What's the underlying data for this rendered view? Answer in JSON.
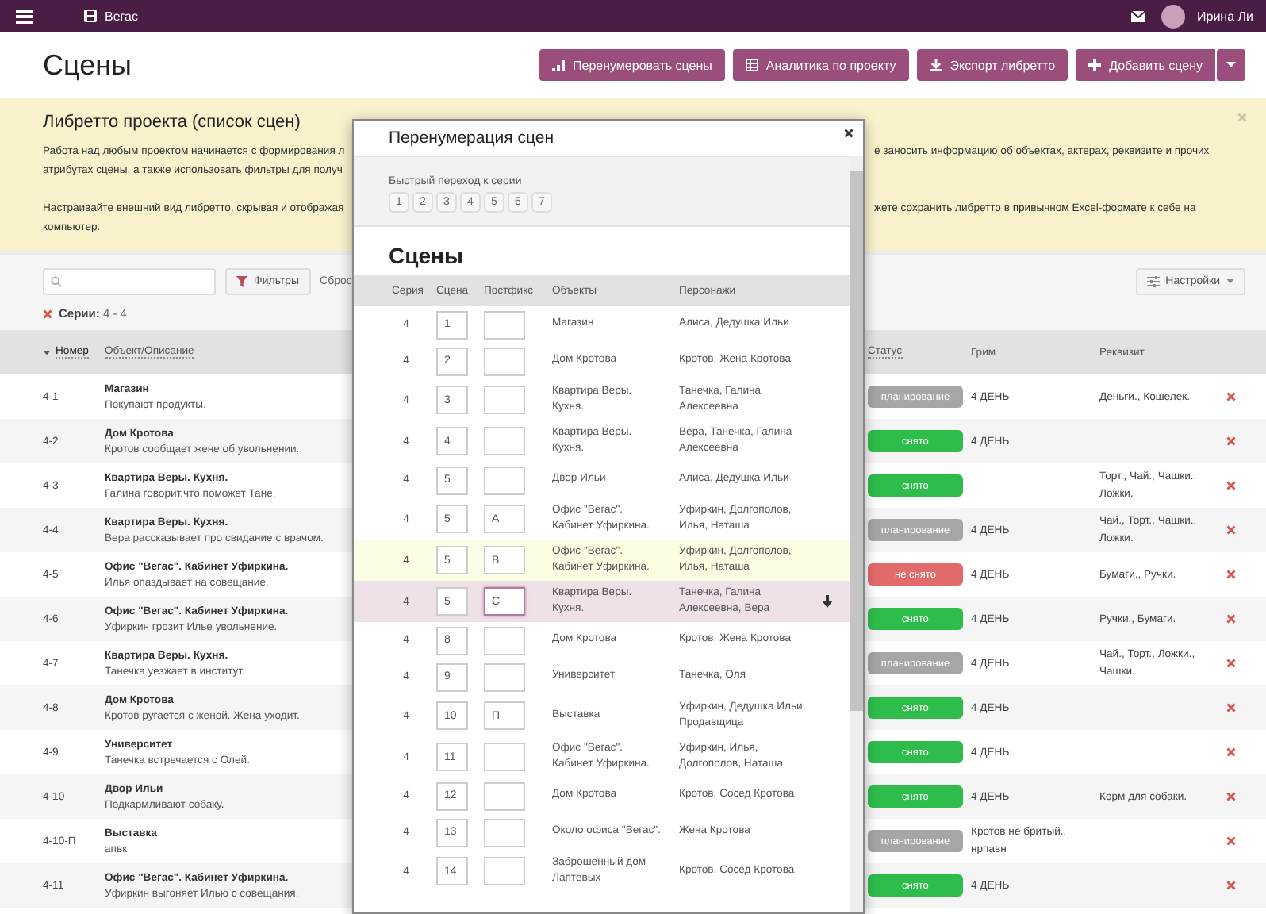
{
  "topbar": {
    "project": "Вегас",
    "user": "Ирина Ли"
  },
  "header": {
    "title": "Сцены",
    "buttons": [
      {
        "label": "Перенумеровать сцены",
        "kind": "bars",
        "dropdown": false
      },
      {
        "label": "Аналитика по проекту",
        "kind": "table",
        "dropdown": false
      },
      {
        "label": "Экспорт либретто",
        "kind": "download",
        "dropdown": false
      },
      {
        "label": "Добавить сцену",
        "kind": "plus",
        "dropdown": true
      }
    ]
  },
  "info": {
    "title": "Либретто проекта (список сцен)",
    "paragraphs": [
      [
        {
          "left": "Работа над любым проектом начинается с формирования л",
          "right": "е заносить информацию об объектах, актерах, реквизите и прочих"
        },
        {
          "left": "атрибутах сцены, а также использовать фильтры для получ"
        }
      ],
      [
        {
          "left": "Настраивайте внешний вид либретто, скрывая и отображая",
          "right": "жете сохранить либретто в привычном Excel-формате к себе на"
        },
        {
          "left": "компьютер."
        }
      ]
    ]
  },
  "filters": {
    "filter_button": "Фильтры",
    "reset_link": "Сброс",
    "active_filter": "**Серии:** 4 - 4",
    "settings_button": "Настройки"
  },
  "table": {
    "columns": [
      {
        "label": "Номер",
        "sorted": true,
        "sortable": true
      },
      {
        "label": "Объект/Описание",
        "sorted": false,
        "sortable": true
      },
      {
        "label": "Статус",
        "sorted": false,
        "sortable": true
      },
      {
        "label": "Грим",
        "sorted": false,
        "sortable": false
      },
      {
        "label": "Реквизит",
        "sorted": false,
        "sortable": false
      }
    ],
    "rows": [
      {
        "number": "4-1",
        "object": "Магазин",
        "description": "Покупают продукты.",
        "status": "планирование",
        "color": "#a6a6a6",
        "makeup": "4 ДЕНЬ",
        "props": "Деньги., Кошелек."
      },
      {
        "number": "4-2",
        "object": "Дом Кротова",
        "description": "Кротов сообщает жене об увольнении.",
        "status": "снято",
        "color": "#2ebd4a",
        "makeup": "4 ДЕНЬ"
      },
      {
        "number": "4-3",
        "object": "Квартира Веры. Кухня.",
        "description": "Галина говорит,что поможет Тане.",
        "status": "снято",
        "color": "#2ebd4a",
        "props": "Торт., Чай., Чашки., Ложки."
      },
      {
        "number": "4-4",
        "object": "Квартира Веры. Кухня.",
        "description": "Вера рассказывает про свидание с врачом.",
        "status": "планирование",
        "color": "#a6a6a6",
        "makeup": "4 ДЕНЬ",
        "props": "Чай., Торт., Чашки., Ложки."
      },
      {
        "number": "4-5",
        "object": "Офис \"Вегас\". Кабинет Уфиркина.",
        "description": "Илья опаздывает на совещание.",
        "status": "не снято",
        "color": "#e36a6a",
        "makeup": "4 ДЕНЬ",
        "props": "Бумаги., Ручки."
      },
      {
        "number": "4-6",
        "object": "Офис \"Вегас\". Кабинет Уфиркина.",
        "description": "Уфиркин грозит Илье увольнение.",
        "status": "снято",
        "color": "#2ebd4a",
        "makeup": "4 ДЕНЬ",
        "props": "Ручки., Бумаги."
      },
      {
        "number": "4-7",
        "object": "Квартира Веры. Кухня.",
        "description": "Танечка уезжает в институт.",
        "status": "планирование",
        "color": "#a6a6a6",
        "makeup": "4 ДЕНЬ",
        "props": "Чай., Торт., Ложки., Чашки."
      },
      {
        "number": "4-8",
        "object": "Дом Кротова",
        "description": "Кротов ругается с женой. Жена уходит.",
        "status": "снято",
        "color": "#2ebd4a",
        "makeup": "4 ДЕНЬ"
      },
      {
        "number": "4-9",
        "object": "Университет",
        "description": "Танечка встречается с Олей.",
        "status": "снято",
        "color": "#2ebd4a",
        "makeup": "4 ДЕНЬ"
      },
      {
        "number": "4-10",
        "object": "Двор Ильи",
        "description": "Подкармливают собаку.",
        "status": "снято",
        "color": "#2ebd4a",
        "makeup": "4 ДЕНЬ",
        "props": "Корм для собаки."
      },
      {
        "number": "4-10-П",
        "object": "Выставка",
        "description": "апвк",
        "status": "планирование",
        "color": "#a6a6a6",
        "makeup": "Кротов не бритый., нрпавн"
      },
      {
        "number": "4-11",
        "object": "Офис \"Вегас\". Кабинет Уфиркина.",
        "description": "Уфиркин выгоняет Илью с совещания.",
        "status": "снято",
        "color": "#2ebd4a",
        "makeup": "4 ДЕНЬ"
      }
    ]
  },
  "modal": {
    "title": "Перенумерация сцен",
    "quick_jump": {
      "label": "Быстрый переход к серии",
      "episodes": [
        "1",
        "2",
        "3",
        "4",
        "5",
        "6",
        "7"
      ]
    },
    "heading": "Сцены",
    "columns": [
      "Серия",
      "Сцена",
      "Постфикс",
      "Объекты",
      "Персонажи"
    ],
    "rows": [
      {
        "series": "4",
        "scene": "1",
        "objects": "Магазин",
        "characters": "Алиса, Дедушка Ильи",
        "hovered": false,
        "selected": false
      },
      {
        "series": "4",
        "scene": "2",
        "objects": "Дом Кротова",
        "characters": "Кротов, Жена Кротова",
        "hovered": false,
        "selected": false
      },
      {
        "series": "4",
        "scene": "3",
        "objects": "Квартира Веры. Кухня.",
        "characters": "Танечка, Галина Алексеевна",
        "hovered": false,
        "selected": false
      },
      {
        "series": "4",
        "scene": "4",
        "objects": "Квартира Веры. Кухня.",
        "characters": "Вера, Танечка, Галина Алексеевна",
        "hovered": false,
        "selected": false
      },
      {
        "series": "4",
        "scene": "5",
        "objects": "Двор Ильи",
        "characters": "Алиса, Дедушка Ильи",
        "hovered": false,
        "selected": false
      },
      {
        "series": "4",
        "scene": "5",
        "postfix": "A",
        "objects": "Офис \"Вегас\". Кабинет Уфиркина.",
        "characters": "Уфиркин, Долгополов, Илья, Наташа",
        "hovered": false,
        "selected": false
      },
      {
        "series": "4",
        "scene": "5",
        "postfix": "B",
        "objects": "Офис \"Вегас\". Кабинет Уфиркина.",
        "characters": "Уфиркин, Долгополов, Илья, Наташа",
        "hovered": true,
        "selected": false
      },
      {
        "series": "4",
        "scene": "5",
        "postfix": "C",
        "objects": "Квартира Веры. Кухня.",
        "characters": "Танечка, Галина Алексеевна, Вера",
        "hovered": false,
        "selected": true
      },
      {
        "series": "4",
        "scene": "8",
        "objects": "Дом Кротова",
        "characters": "Кротов, Жена Кротова",
        "hovered": false,
        "selected": false
      },
      {
        "series": "4",
        "scene": "9",
        "objects": "Университет",
        "characters": "Танечка, Оля",
        "hovered": false,
        "selected": false
      },
      {
        "series": "4",
        "scene": "10",
        "postfix": "П",
        "objects": "Выставка",
        "characters": "Уфиркин, Дедушка Ильи, Продавщица",
        "hovered": false,
        "selected": false
      },
      {
        "series": "4",
        "scene": "11",
        "objects": "Офис \"Вегас\". Кабинет Уфиркина.",
        "characters": "Уфиркин, Илья, Долгополов, Наташа",
        "hovered": false,
        "selected": false
      },
      {
        "series": "4",
        "scene": "12",
        "objects": "Дом Кротова",
        "characters": "Кротов, Сосед Кротова",
        "hovered": false,
        "selected": false
      },
      {
        "series": "4",
        "scene": "13",
        "objects": "Около офиса \"Вегас\".",
        "characters": "Жена Кротова",
        "hovered": false,
        "selected": false
      },
      {
        "series": "4",
        "scene": "14",
        "objects": "Заброшенный дом Лаптевых",
        "characters": "Кротов, Сосед Кротова",
        "hovered": false,
        "selected": false
      }
    ]
  }
}
